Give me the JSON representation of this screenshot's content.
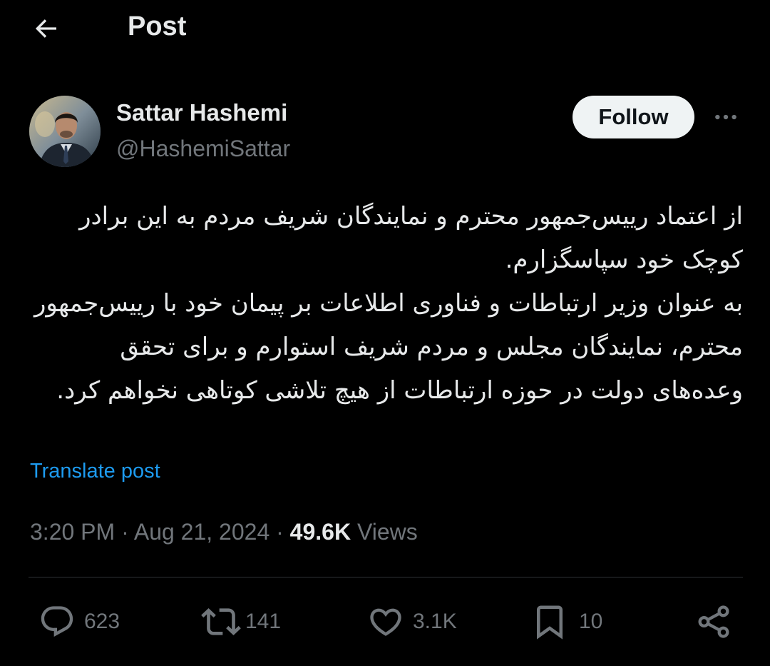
{
  "header": {
    "title": "Post",
    "back_icon": "arrow-left-icon"
  },
  "author": {
    "name": "Sattar Hashemi",
    "handle": "@HashemiSattar",
    "avatar_icon": "profile-photo"
  },
  "follow_button": {
    "label": "Follow"
  },
  "more_icon": "ellipsis-icon",
  "post": {
    "paragraphs": [
      "از اعتماد رییس‌جمهور محترم و نمایندگان شریف مردم به این برادر کوچک خود سپاسگزارم.",
      "به عنوان وزیر ارتباطات و فناوری اطلاعات بر پیمان خود با رییس‌جمهور محترم، نمایندگان مجلس و مردم شریف استوارم و برای تحقق وعده‌های دولت در حوزه ارتباطات از هیچ تلاشی کوتاهی نخواهم کرد."
    ],
    "translate_label": "Translate post",
    "time": "3:20 PM",
    "date": "Aug 21, 2024",
    "separator": "·",
    "views_count": "49.6K",
    "views_label": "Views"
  },
  "actions": {
    "reply": {
      "icon": "reply-icon",
      "count": "623"
    },
    "repost": {
      "icon": "repost-icon",
      "count": "141"
    },
    "like": {
      "icon": "heart-icon",
      "count": "3.1K"
    },
    "bookmark": {
      "icon": "bookmark-icon",
      "count": "10"
    },
    "share": {
      "icon": "share-icon"
    }
  },
  "colors": {
    "background": "#000000",
    "text_primary": "#e7e9ea",
    "text_secondary": "#71767b",
    "link": "#1d9bf0",
    "follow_bg": "#eff3f4",
    "divider": "#2f3336"
  }
}
